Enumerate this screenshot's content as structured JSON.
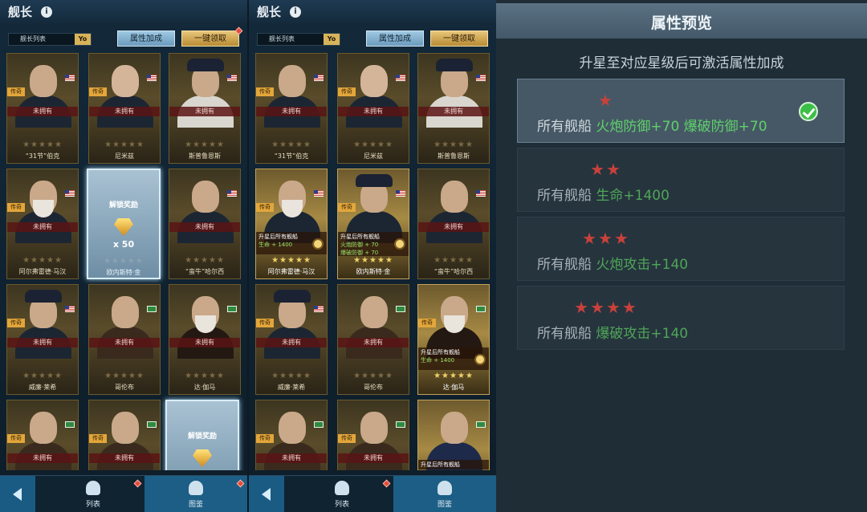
{
  "panels": [
    {
      "header_title": "舰长",
      "list_label": "舰长列表",
      "filter_chip": "Yo",
      "attr_button": "属性加成",
      "claim_button": "一键领取",
      "cards": [
        {
          "name": "“31节”伯克",
          "status": "未拥有",
          "rarity": "传奇",
          "stars": "★★★★★",
          "flag": "us"
        },
        {
          "name": "尼米兹",
          "status": "未拥有",
          "rarity": "传奇",
          "stars": "★★★★★",
          "flag": "us"
        },
        {
          "name": "斯普鲁恩斯",
          "status": "未拥有",
          "rarity": "",
          "stars": "★★★★★",
          "flag": "us"
        },
        {
          "name": "阿尔弗雷德·马汉",
          "status": "未拥有",
          "rarity": "传奇",
          "stars": "★★★★★",
          "flag": "us"
        },
        {
          "name": "欧内斯特·金",
          "reward_title": "解锁奖励",
          "reward_qty": "x 50",
          "stars": "★★★★★"
        },
        {
          "name": "“蛮牛”哈尔西",
          "status": "未拥有",
          "rarity": "",
          "stars": "★★★★★",
          "flag": "us"
        },
        {
          "name": "威廉·莱希",
          "status": "未拥有",
          "rarity": "传奇",
          "stars": "★★★★★",
          "flag": "us"
        },
        {
          "name": "哥伦布",
          "status": "未拥有",
          "rarity": "",
          "stars": "★★★★★",
          "flag": "green"
        },
        {
          "name": "达·伽马",
          "status": "未拥有",
          "rarity": "",
          "stars": "★★★★★",
          "flag": "green"
        },
        {
          "name": "",
          "status": "未拥有",
          "rarity": "传奇",
          "stars": "",
          "flag": "green"
        },
        {
          "name": "",
          "status": "未拥有",
          "rarity": "传奇",
          "stars": "",
          "flag": "green"
        },
        {
          "name": "",
          "reward_title": "解锁奖励",
          "reward_qty": "",
          "stars": ""
        }
      ],
      "nav": {
        "list": "列表",
        "guide": "图鉴"
      }
    },
    {
      "header_title": "舰长",
      "list_label": "舰长列表",
      "filter_chip": "Yo",
      "attr_button": "属性加成",
      "claim_button": "一键领取",
      "cards": [
        {
          "name": "“31节”伯克",
          "status": "未拥有",
          "rarity": "传奇",
          "stars": "★★★★★",
          "flag": "us"
        },
        {
          "name": "尼米兹",
          "status": "未拥有",
          "rarity": "传奇",
          "stars": "★★★★★",
          "flag": "us"
        },
        {
          "name": "斯普鲁恩斯",
          "status": "未拥有",
          "rarity": "",
          "stars": "★★★★★",
          "flag": "us"
        },
        {
          "name": "阿尔弗雷德·马汉",
          "owned": true,
          "rarity": "传奇",
          "stars": "★★★★★",
          "flag": "us",
          "bonus_title": "升星后所有舰船",
          "bonus_lines": [
            "生命 + 1400"
          ]
        },
        {
          "name": "欧内斯特·金",
          "owned": true,
          "rarity": "传奇",
          "stars": "★★★★★",
          "flag": "us",
          "bonus_title": "升星后所有舰船",
          "bonus_lines": [
            "火炮防御 + 70",
            "爆破防御 + 70"
          ]
        },
        {
          "name": "“蛮牛”哈尔西",
          "status": "未拥有",
          "rarity": "",
          "stars": "★★★★★",
          "flag": "us"
        },
        {
          "name": "威廉·莱希",
          "status": "未拥有",
          "rarity": "传奇",
          "stars": "★★★★★",
          "flag": "us"
        },
        {
          "name": "哥伦布",
          "status": "未拥有",
          "rarity": "",
          "stars": "★★★★★",
          "flag": "green"
        },
        {
          "name": "达·伽马",
          "owned": true,
          "rarity": "传奇",
          "stars": "★★★★★",
          "flag": "green",
          "bonus_title": "升星后所有舰船",
          "bonus_lines": [
            "生命 + 1400"
          ]
        },
        {
          "name": "",
          "status": "未拥有",
          "rarity": "传奇",
          "stars": "",
          "flag": "green"
        },
        {
          "name": "",
          "status": "未拥有",
          "rarity": "传奇",
          "stars": "",
          "flag": "green"
        },
        {
          "name": "",
          "owned": true,
          "rarity": "",
          "stars": "",
          "flag": "green",
          "bonus_title": "升星后所有舰船",
          "bonus_lines": []
        }
      ],
      "nav": {
        "list": "列表",
        "guide": "图鉴"
      }
    }
  ],
  "preview": {
    "title": "属性预览",
    "subtitle": "升星至对应星级后可激活属性加成",
    "tiers": [
      {
        "stars": "★",
        "prefix": "所有舰船",
        "bonus": "火炮防御+70 爆破防御+70",
        "active": true
      },
      {
        "stars": "★★",
        "prefix": "所有舰船",
        "bonus": "生命+1400",
        "active": false
      },
      {
        "stars": "★★★",
        "prefix": "所有舰船",
        "bonus": "火炮攻击+140",
        "active": false
      },
      {
        "stars": "★★★★",
        "prefix": "所有舰船",
        "bonus": "爆破攻击+140",
        "active": false
      }
    ]
  },
  "colors": {
    "accent_blue": "#6b9bbd",
    "gold": "#d8b35a",
    "green_bonus": "#5fd16a",
    "star_red": "#c8413a"
  }
}
